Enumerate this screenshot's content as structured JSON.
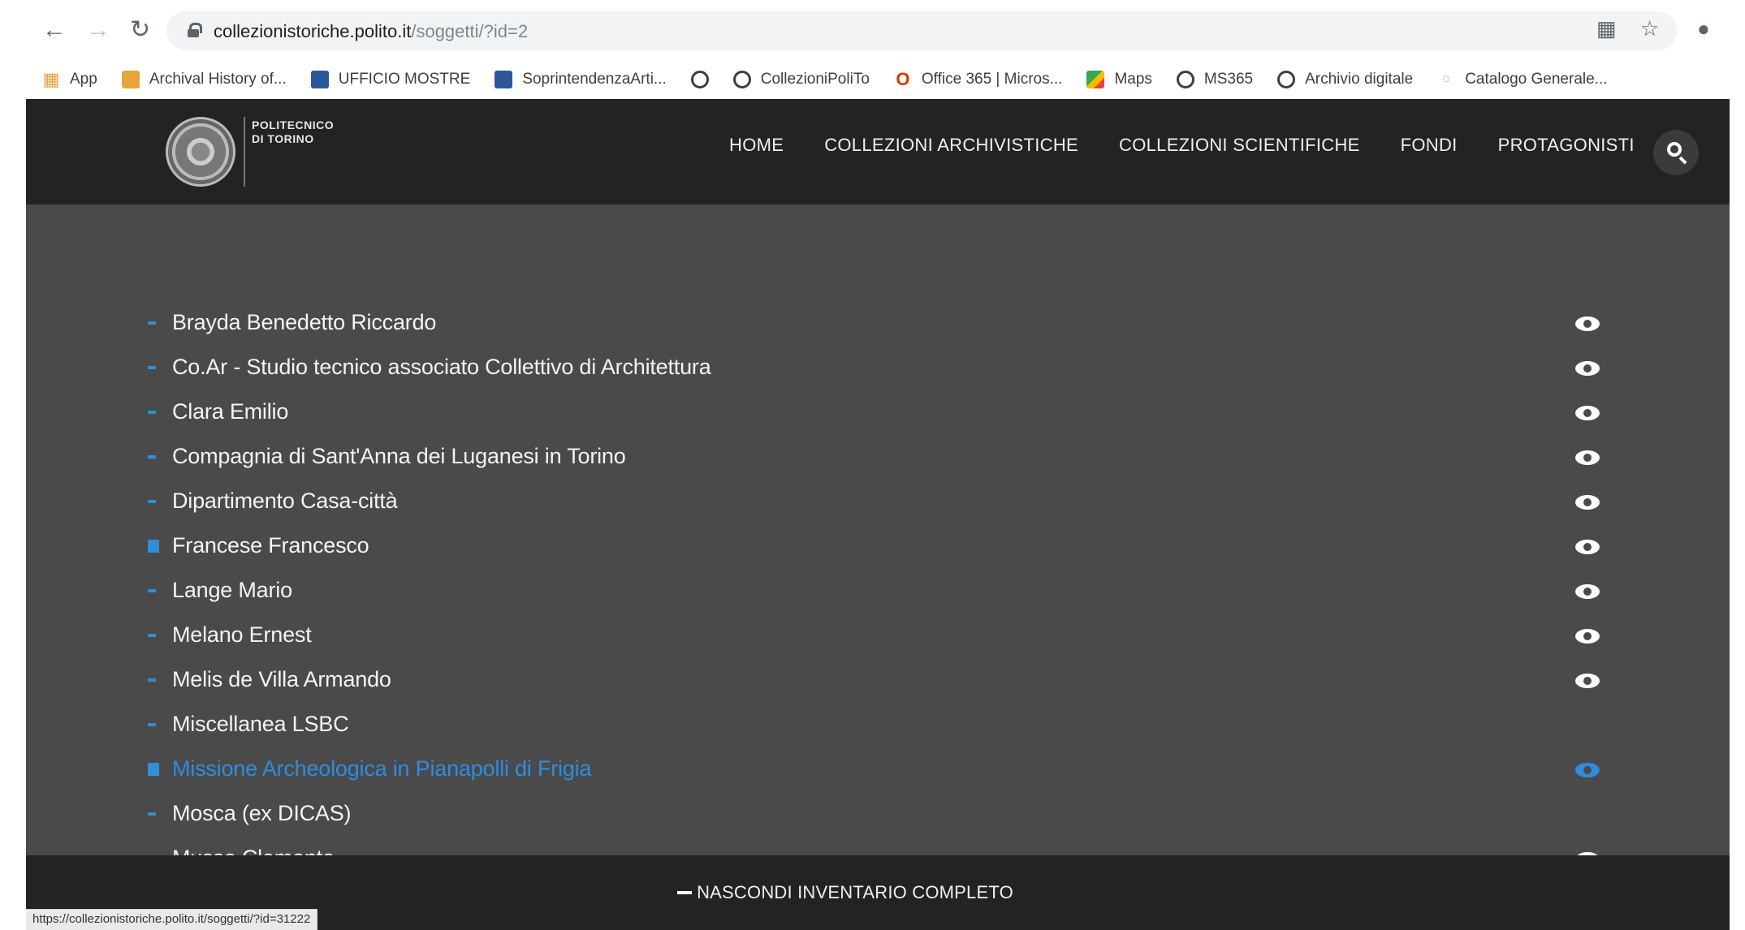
{
  "browser": {
    "back_icon": "arrow-left-icon",
    "forward_icon": "arrow-right-icon",
    "reload_icon": "reload-icon",
    "url_host": "collezionistoriche.polito.it",
    "url_path": "/soggetti/?id=2",
    "translate_icon": "translate-icon",
    "star_icon": "star-icon",
    "profile_icon": "profile-icon"
  },
  "bookmarks": [
    {
      "label": "App",
      "icon": "apps-icon"
    },
    {
      "label": "Archival History of...",
      "icon": "cube-icon"
    },
    {
      "label": "UFFICIO MOSTRE",
      "icon": "blue-square-icon"
    },
    {
      "label": "SoprintendenzaArti...",
      "icon": "blue-square-icon"
    },
    {
      "label": "",
      "icon": "globe-icon"
    },
    {
      "label": "CollezioniPoliTo",
      "icon": "globe-icon"
    },
    {
      "label": "Office 365 | Micros...",
      "icon": "office-icon"
    },
    {
      "label": "Maps",
      "icon": "maps-icon"
    },
    {
      "label": "MS365",
      "icon": "globe-icon"
    },
    {
      "label": "Archivio digitale",
      "icon": "globe-icon"
    },
    {
      "label": "Catalogo Generale...",
      "icon": "catalog-icon"
    }
  ],
  "site": {
    "logo_text": "POLITECNICO DI TORINO",
    "nav": [
      "HOME",
      "COLLEZIONI ARCHIVISTICHE",
      "COLLEZIONI SCIENTIFICHE",
      "FONDI",
      "PROTAGONISTI"
    ],
    "search_icon": "search-icon",
    "accent_color": "#2d8de0",
    "header_color": "#232323",
    "content_bg": "#4a4a4a"
  },
  "list": {
    "items": [
      {
        "label": "Brayda Benedetto Riccardo",
        "active": false
      },
      {
        "label": "Co.Ar - Studio tecnico associato Collettivo di Architettura",
        "active": false
      },
      {
        "label": "Clara Emilio",
        "active": false
      },
      {
        "label": "Compagnia di Sant'Anna dei Luganesi in Torino",
        "active": false
      },
      {
        "label": "Dipartimento Casa-città",
        "active": false
      },
      {
        "label": "Francese Francesco",
        "active": false
      },
      {
        "label": "Lange Mario",
        "active": false
      },
      {
        "label": "Melano Ernest",
        "active": false
      },
      {
        "label": "Melis de Villa Armando",
        "active": false
      },
      {
        "label": "Miscellanea LSBC",
        "active": false
      },
      {
        "label": "Missione Archeologica in Pianapolli di Frigia",
        "active": true
      },
      {
        "label": "Mosca (ex DICAS)",
        "active": false
      },
      {
        "label": "Musso Clemente",
        "active": false
      }
    ],
    "eye_icon": "eye-icon"
  },
  "footer": {
    "toggle_label": "NASCONDI INVENTARIO COMPLETO"
  },
  "status_bar": {
    "url": "https://collezionistoriche.polito.it/soggetti/?id=31222"
  }
}
